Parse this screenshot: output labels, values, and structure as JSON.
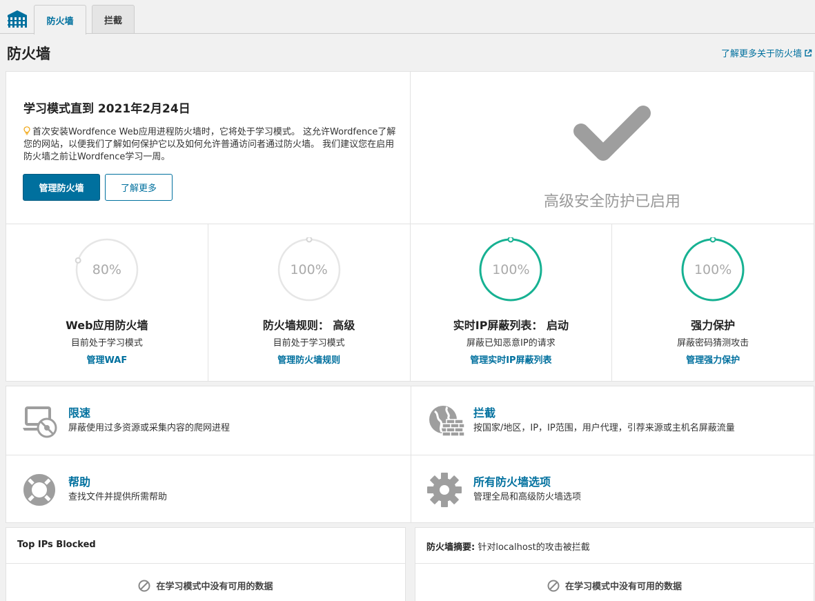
{
  "tabs": [
    {
      "label": "防火墙",
      "active": true
    },
    {
      "label": "拦截",
      "active": false
    }
  ],
  "header": {
    "title": "防火墙",
    "learn_more": "了解更多关于防火墙"
  },
  "learning": {
    "title": "学习模式直到 2021年2月24日",
    "description": "首次安装Wordfence Web应用进程防火墙时，它将处于学习模式。 这允许Wordfence了解您的网站，以便我们了解如何保护它以及如何允许普通访问者通过防火墙。 我们建议您在启用防火墙之前让Wordfence学习一周。",
    "manage_button": "管理防火墙",
    "learn_button": "了解更多"
  },
  "protection": {
    "status": "高级安全防护已启用"
  },
  "stats": [
    {
      "percent": "80%",
      "value": 0.8,
      "active": false,
      "title": "Web应用防火墙",
      "subtitle": "目前处于学习模式",
      "link": "管理WAF"
    },
    {
      "percent": "100%",
      "value": 1.0,
      "active": false,
      "title": "防火墙规则： 高级",
      "subtitle": "目前处于学习模式",
      "link": "管理防火墙规则"
    },
    {
      "percent": "100%",
      "value": 1.0,
      "active": true,
      "title": "实时IP屏蔽列表： 启动",
      "subtitle": "屏蔽已知恶意IP的请求",
      "link": "管理实时IP屏蔽列表"
    },
    {
      "percent": "100%",
      "value": 1.0,
      "active": true,
      "title": "强力保护",
      "subtitle": "屏蔽密码猜测攻击",
      "link": "管理强力保护"
    }
  ],
  "features": [
    {
      "icon": "laptop-block-icon",
      "title": "限速",
      "desc": "屏蔽使用过多资源或采集内容的爬网进程"
    },
    {
      "icon": "globe-wall-icon",
      "title": "拦截",
      "desc": "按国家/地区，IP，IP范围，用户代理，引荐来源或主机名屏蔽流量"
    },
    {
      "icon": "lifebuoy-icon",
      "title": "帮助",
      "desc": "查找文件并提供所需帮助"
    },
    {
      "icon": "gear-icon",
      "title": "所有防火墙选项",
      "desc": "管理全局和高级防火墙选项"
    }
  ],
  "cards": {
    "top_ips": {
      "title": "Top IPs Blocked",
      "empty": "在学习模式中没有可用的数据"
    },
    "summary": {
      "title_bold": "防火墙摘要:",
      "title_rest": " 针对localhost的攻击被拦截",
      "empty": "在学习模式中没有可用的数据"
    }
  },
  "colors": {
    "accent": "#00709e",
    "gauge_active": "#16b192",
    "gauge_inactive": "#e6e6e6",
    "icon_gray": "#9e9e9e"
  }
}
